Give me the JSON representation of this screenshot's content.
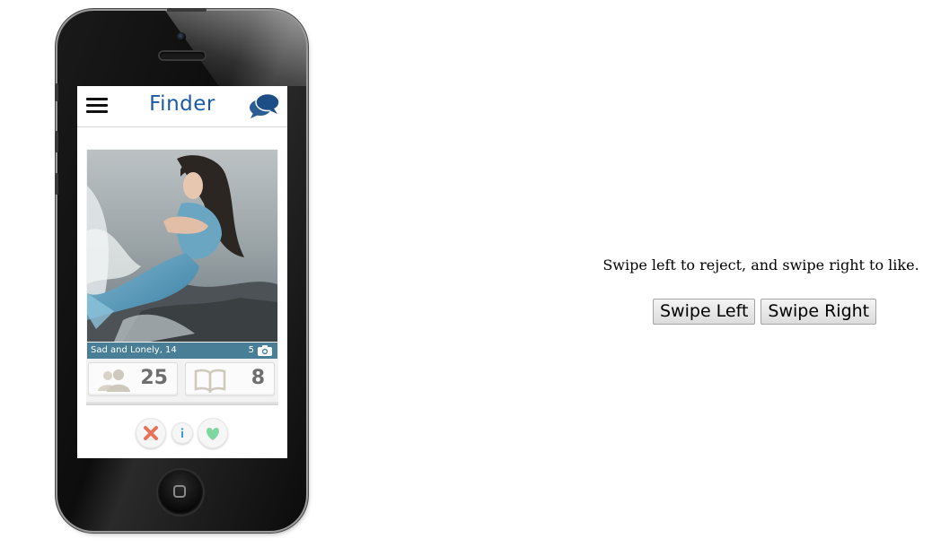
{
  "app": {
    "logo_text": "Finder",
    "brand_color": "#1a5aa4",
    "menu_icon": "hamburger-menu-icon",
    "chat_icon": "chat-bubbles-icon"
  },
  "profile": {
    "name_age": "Sad and Lonely, 14",
    "photo_count": "5",
    "photo_icon": "camera-icon",
    "friends_count": "25",
    "friends_icon": "friends-icon",
    "interests_count": "8",
    "interests_icon": "book-icon",
    "caption_color": "#487e96"
  },
  "actions": {
    "reject_icon": "x-icon",
    "info_icon": "info-icon",
    "like_icon": "heart-icon"
  },
  "instructions": {
    "text": "Swipe left to reject, and swipe right to like.",
    "swipe_left_label": "Swipe Left",
    "swipe_right_label": "Swipe Right"
  }
}
